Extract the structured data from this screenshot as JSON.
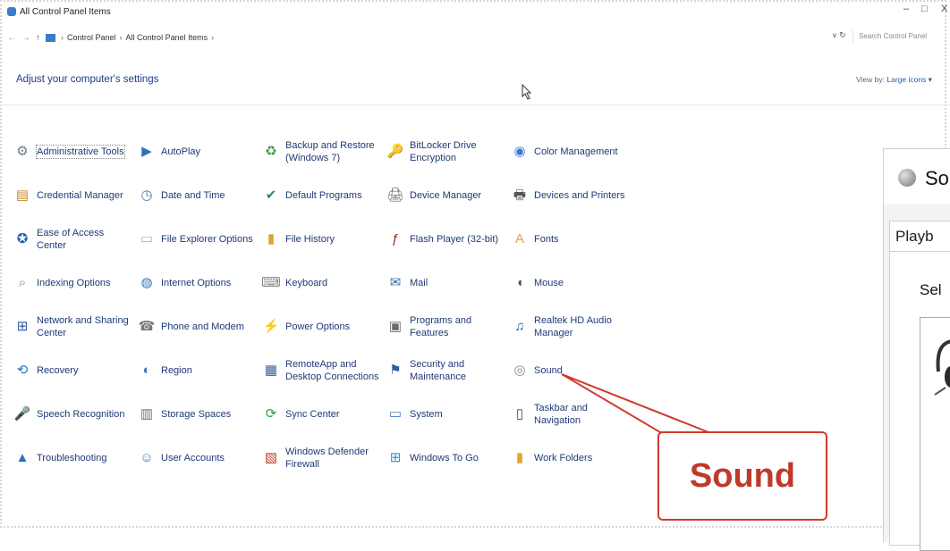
{
  "window": {
    "title": "All Control Panel Items",
    "controls": {
      "minimize": "–",
      "maximize": "□",
      "close": "X"
    }
  },
  "address": {
    "back": "←",
    "forward": "→",
    "up": "↑",
    "crumbs": [
      "Control Panel",
      "All Control Panel Items"
    ],
    "refresh": "↻",
    "search_placeholder": "Search Control Panel"
  },
  "header": {
    "heading": "Adjust your computer's settings",
    "view_by_label": "View by:",
    "view_by_value": "Large icons ▾"
  },
  "items": [
    {
      "label": "Administrative Tools",
      "icon": "admin-tools-icon",
      "glyph": "⚙",
      "color": "#6b7b8c",
      "selected": true
    },
    {
      "label": "AutoPlay",
      "icon": "autoplay-icon",
      "glyph": "▶",
      "color": "#2f6fbf"
    },
    {
      "label": "Backup and Restore (Windows 7)",
      "icon": "backup-icon",
      "glyph": "♻",
      "color": "#3c9a3c"
    },
    {
      "label": "BitLocker Drive Encryption",
      "icon": "bitlocker-icon",
      "glyph": "🔑",
      "color": "#b88a2a"
    },
    {
      "label": "Color Management",
      "icon": "color-management-icon",
      "glyph": "◉",
      "color": "#3a7bd5"
    },
    {
      "label": "Credential Manager",
      "icon": "credential-manager-icon",
      "glyph": "▤",
      "color": "#c48a2b"
    },
    {
      "label": "Date and Time",
      "icon": "date-time-icon",
      "glyph": "◷",
      "color": "#4a7ab8"
    },
    {
      "label": "Default Programs",
      "icon": "default-programs-icon",
      "glyph": "✔",
      "color": "#2e8b57"
    },
    {
      "label": "Device Manager",
      "icon": "device-manager-icon",
      "glyph": "🖨",
      "color": "#666666"
    },
    {
      "label": "Devices and Printers",
      "icon": "devices-printers-icon",
      "glyph": "🖶",
      "color": "#555555"
    },
    {
      "label": "Ease of Access Center",
      "icon": "ease-of-access-icon",
      "glyph": "✪",
      "color": "#1f5fa8"
    },
    {
      "label": "File Explorer Options",
      "icon": "file-explorer-options-icon",
      "glyph": "▭",
      "color": "#d9b54a"
    },
    {
      "label": "File History",
      "icon": "file-history-icon",
      "glyph": "▮",
      "color": "#e0a52f"
    },
    {
      "label": "Flash Player (32-bit)",
      "icon": "flash-player-icon",
      "glyph": "ƒ",
      "color": "#b01e1e"
    },
    {
      "label": "Fonts",
      "icon": "fonts-icon",
      "glyph": "A",
      "color": "#d9a43a"
    },
    {
      "label": "Indexing Options",
      "icon": "indexing-options-icon",
      "glyph": "⌕",
      "color": "#7b8a9a"
    },
    {
      "label": "Internet Options",
      "icon": "internet-options-icon",
      "glyph": "◍",
      "color": "#2f7bc4"
    },
    {
      "label": "Keyboard",
      "icon": "keyboard-icon",
      "glyph": "⌨",
      "color": "#888888"
    },
    {
      "label": "Mail",
      "icon": "mail-icon",
      "glyph": "✉",
      "color": "#3a6fb0"
    },
    {
      "label": "Mouse",
      "icon": "mouse-icon",
      "glyph": "◖",
      "color": "#555555"
    },
    {
      "label": "Network and Sharing Center",
      "icon": "network-sharing-icon",
      "glyph": "⊞",
      "color": "#2d5aa0"
    },
    {
      "label": "Phone and Modem",
      "icon": "phone-modem-icon",
      "glyph": "☎",
      "color": "#777777"
    },
    {
      "label": "Power Options",
      "icon": "power-options-icon",
      "glyph": "⚡",
      "color": "#3c8a3c"
    },
    {
      "label": "Programs and Features",
      "icon": "programs-features-icon",
      "glyph": "▣",
      "color": "#6a6a6a"
    },
    {
      "label": "Realtek HD Audio Manager",
      "icon": "realtek-audio-icon",
      "glyph": "♫",
      "color": "#2f5da8"
    },
    {
      "label": "Recovery",
      "icon": "recovery-icon",
      "glyph": "⟲",
      "color": "#2f6fbf"
    },
    {
      "label": "Region",
      "icon": "region-icon",
      "glyph": "◐",
      "color": "#3b7dc4"
    },
    {
      "label": "RemoteApp and Desktop Connections",
      "icon": "remoteapp-icon",
      "glyph": "▦",
      "color": "#3a5f9a"
    },
    {
      "label": "Security and Maintenance",
      "icon": "security-maintenance-icon",
      "glyph": "⚑",
      "color": "#2f5da8"
    },
    {
      "label": "Sound",
      "icon": "sound-icon",
      "glyph": "◎",
      "color": "#8a8a8a"
    },
    {
      "label": "Speech Recognition",
      "icon": "speech-recognition-icon",
      "glyph": "🎤",
      "color": "#777777"
    },
    {
      "label": "Storage Spaces",
      "icon": "storage-spaces-icon",
      "glyph": "▥",
      "color": "#6f6f6f"
    },
    {
      "label": "Sync Center",
      "icon": "sync-center-icon",
      "glyph": "⟳",
      "color": "#2e9a3a"
    },
    {
      "label": "System",
      "icon": "system-icon",
      "glyph": "▭",
      "color": "#3b7dc4"
    },
    {
      "label": "Taskbar and Navigation",
      "icon": "taskbar-navigation-icon",
      "glyph": "▯",
      "color": "#4a4a4a"
    },
    {
      "label": "Troubleshooting",
      "icon": "troubleshooting-icon",
      "glyph": "▲",
      "color": "#2f6fbf"
    },
    {
      "label": "User Accounts",
      "icon": "user-accounts-icon",
      "glyph": "☺",
      "color": "#4a7ab8"
    },
    {
      "label": "Windows Defender Firewall",
      "icon": "firewall-icon",
      "glyph": "▧",
      "color": "#b5452a"
    },
    {
      "label": "Windows To Go",
      "icon": "windows-to-go-icon",
      "glyph": "⊞",
      "color": "#3a8fd0"
    },
    {
      "label": "Work Folders",
      "icon": "work-folders-icon",
      "glyph": "▮",
      "color": "#e0a52f"
    }
  ],
  "callout": {
    "text": "Sound",
    "color": "#c0392b"
  },
  "sound_dialog": {
    "title": "So",
    "tab": "Playb",
    "instruction": "Sel"
  }
}
